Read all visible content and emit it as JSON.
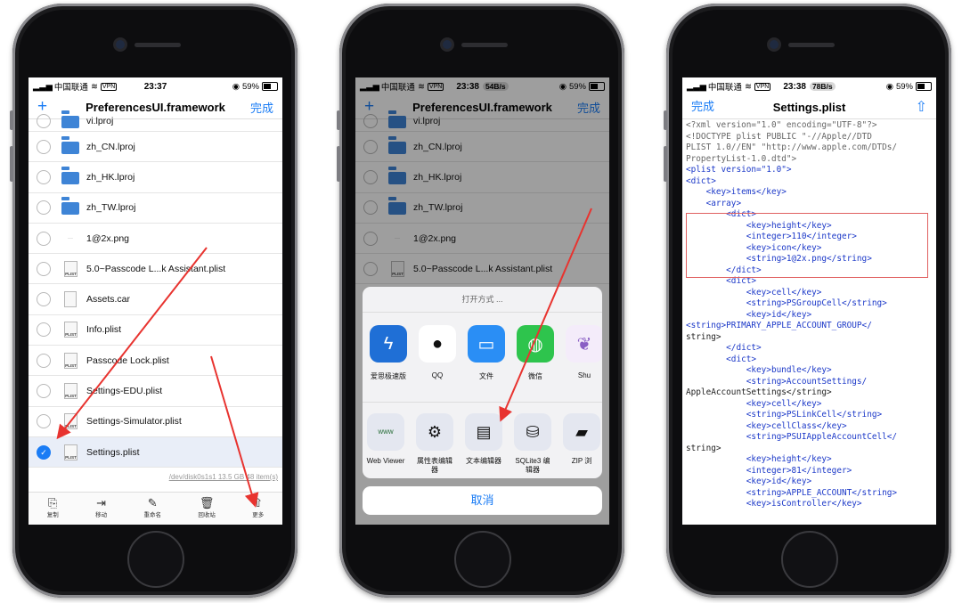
{
  "status_common": {
    "carrier": "中国联通",
    "vpn": "VPN",
    "battery": "59%"
  },
  "phone1": {
    "time": "23:37",
    "nav": {
      "left": "+",
      "title": "PreferencesUI.framework",
      "right": "完成"
    },
    "files": [
      {
        "name": "vi.lproj",
        "kind": "folder"
      },
      {
        "name": "zh_CN.lproj",
        "kind": "folder"
      },
      {
        "name": "zh_HK.lproj",
        "kind": "folder"
      },
      {
        "name": "zh_TW.lproj",
        "kind": "folder"
      },
      {
        "name": "1@2x.png",
        "kind": "png"
      },
      {
        "name": "5.0~Passcode L...k Assistant.plist",
        "kind": "plist"
      },
      {
        "name": "Assets.car",
        "kind": "doc"
      },
      {
        "name": "Info.plist",
        "kind": "plist"
      },
      {
        "name": "Passcode Lock.plist",
        "kind": "plist"
      },
      {
        "name": "Settings-EDU.plist",
        "kind": "plist"
      },
      {
        "name": "Settings-Simulator.plist",
        "kind": "plist"
      },
      {
        "name": "Settings.plist",
        "kind": "plist"
      }
    ],
    "path_info": "/dev/disk0s1s1   13.5 GB   48 item(s)",
    "toolbar": [
      "复制",
      "移动",
      "重命名",
      "回收站",
      "更多"
    ]
  },
  "phone2": {
    "time": "23:38",
    "speed": "54B/s",
    "nav": {
      "left": "+",
      "title": "PreferencesUI.framework",
      "right": "完成"
    },
    "files": [
      "vi.lproj",
      "zh_CN.lproj",
      "zh_HK.lproj",
      "zh_TW.lproj",
      "1@2x.png",
      "5.0~Passcode L...k Assistant.plist"
    ],
    "sheet_title": "打开方式 ...",
    "apps": [
      {
        "label": "爱思极速版",
        "icon": "lightning-icon",
        "color": "#1f6fd6"
      },
      {
        "label": "QQ",
        "icon": "penguin-icon",
        "color": "#ffffff"
      },
      {
        "label": "文件",
        "icon": "folder-icon",
        "color": "#2a8ef5"
      },
      {
        "label": "微信",
        "icon": "chat-icon",
        "color": "#2ec44d"
      },
      {
        "label": "Shu",
        "icon": "feather-icon",
        "color": "#f4ecfa"
      }
    ],
    "actions": [
      {
        "label": "Web Viewer",
        "glyph": "www"
      },
      {
        "label": "属性表编辑器",
        "glyph": "⚙"
      },
      {
        "label": "文本编辑器",
        "glyph": "▤"
      },
      {
        "label": "SQLite3 编辑器",
        "glyph": "⛁"
      },
      {
        "label": "ZIP 浏",
        "glyph": "▰"
      }
    ],
    "cancel": "取消"
  },
  "phone3": {
    "time": "23:38",
    "speed": "78B/s",
    "nav": {
      "left": "完成",
      "title": "Settings.plist"
    },
    "code_lines": [
      "<?xml version=\"1.0\" encoding=\"UTF-8\"?>",
      "<!DOCTYPE plist PUBLIC \"-//Apple//DTD",
      "PLIST 1.0//EN\" \"http://www.apple.com/DTDs/",
      "PropertyList-1.0.dtd\">",
      "<plist version=\"1.0\">",
      "<dict>",
      "    <key>items</key>",
      "    <array>",
      "        <dict>",
      "            <key>height</key>",
      "            <integer>110</integer>",
      "            <key>icon</key>",
      "            <string>1@2x.png</string>",
      "        </dict>",
      "        <dict>",
      "            <key>cell</key>",
      "            <string>PSGroupCell</string>",
      "            <key>id</key>",
      "",
      "<string>PRIMARY_APPLE_ACCOUNT_GROUP</",
      "string>",
      "        </dict>",
      "        <dict>",
      "            <key>bundle</key>",
      "            <string>AccountSettings/",
      "AppleAccountSettings</string>",
      "            <key>cell</key>",
      "            <string>PSLinkCell</string>",
      "            <key>cellClass</key>",
      "            <string>PSUIAppleAccountCell</",
      "string>",
      "            <key>height</key>",
      "            <integer>81</integer>",
      "            <key>id</key>",
      "            <string>APPLE_ACCOUNT</string>",
      "            <key>isController</key>"
    ]
  }
}
